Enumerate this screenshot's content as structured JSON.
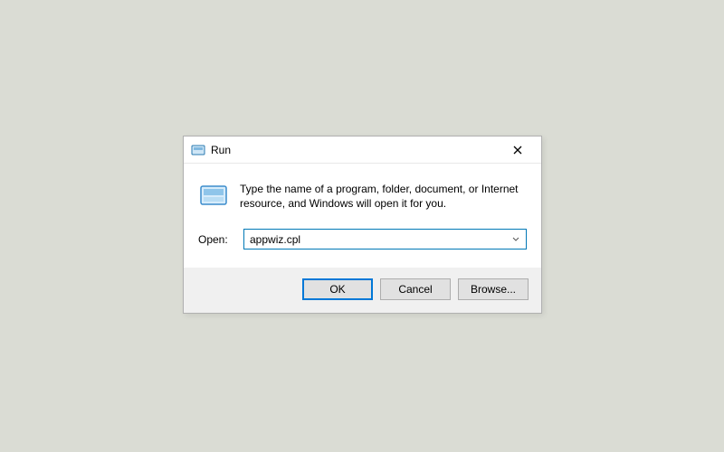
{
  "dialog": {
    "title": "Run",
    "description": "Type the name of a program, folder, document, or Internet resource, and Windows will open it for you.",
    "open_label": "Open:",
    "open_value": "appwiz.cpl",
    "buttons": {
      "ok": "OK",
      "cancel": "Cancel",
      "browse": "Browse..."
    }
  }
}
